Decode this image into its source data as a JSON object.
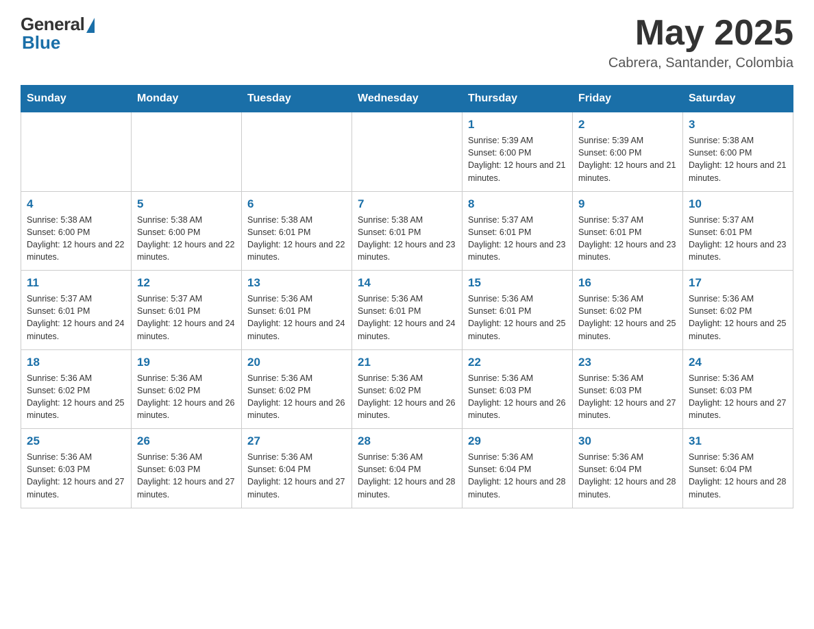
{
  "header": {
    "logo_general": "General",
    "logo_blue": "Blue",
    "month_year": "May 2025",
    "location": "Cabrera, Santander, Colombia"
  },
  "calendar": {
    "days_of_week": [
      "Sunday",
      "Monday",
      "Tuesday",
      "Wednesday",
      "Thursday",
      "Friday",
      "Saturday"
    ],
    "weeks": [
      [
        {
          "day": "",
          "info": ""
        },
        {
          "day": "",
          "info": ""
        },
        {
          "day": "",
          "info": ""
        },
        {
          "day": "",
          "info": ""
        },
        {
          "day": "1",
          "info": "Sunrise: 5:39 AM\nSunset: 6:00 PM\nDaylight: 12 hours and 21 minutes."
        },
        {
          "day": "2",
          "info": "Sunrise: 5:39 AM\nSunset: 6:00 PM\nDaylight: 12 hours and 21 minutes."
        },
        {
          "day": "3",
          "info": "Sunrise: 5:38 AM\nSunset: 6:00 PM\nDaylight: 12 hours and 21 minutes."
        }
      ],
      [
        {
          "day": "4",
          "info": "Sunrise: 5:38 AM\nSunset: 6:00 PM\nDaylight: 12 hours and 22 minutes."
        },
        {
          "day": "5",
          "info": "Sunrise: 5:38 AM\nSunset: 6:00 PM\nDaylight: 12 hours and 22 minutes."
        },
        {
          "day": "6",
          "info": "Sunrise: 5:38 AM\nSunset: 6:01 PM\nDaylight: 12 hours and 22 minutes."
        },
        {
          "day": "7",
          "info": "Sunrise: 5:38 AM\nSunset: 6:01 PM\nDaylight: 12 hours and 23 minutes."
        },
        {
          "day": "8",
          "info": "Sunrise: 5:37 AM\nSunset: 6:01 PM\nDaylight: 12 hours and 23 minutes."
        },
        {
          "day": "9",
          "info": "Sunrise: 5:37 AM\nSunset: 6:01 PM\nDaylight: 12 hours and 23 minutes."
        },
        {
          "day": "10",
          "info": "Sunrise: 5:37 AM\nSunset: 6:01 PM\nDaylight: 12 hours and 23 minutes."
        }
      ],
      [
        {
          "day": "11",
          "info": "Sunrise: 5:37 AM\nSunset: 6:01 PM\nDaylight: 12 hours and 24 minutes."
        },
        {
          "day": "12",
          "info": "Sunrise: 5:37 AM\nSunset: 6:01 PM\nDaylight: 12 hours and 24 minutes."
        },
        {
          "day": "13",
          "info": "Sunrise: 5:36 AM\nSunset: 6:01 PM\nDaylight: 12 hours and 24 minutes."
        },
        {
          "day": "14",
          "info": "Sunrise: 5:36 AM\nSunset: 6:01 PM\nDaylight: 12 hours and 24 minutes."
        },
        {
          "day": "15",
          "info": "Sunrise: 5:36 AM\nSunset: 6:01 PM\nDaylight: 12 hours and 25 minutes."
        },
        {
          "day": "16",
          "info": "Sunrise: 5:36 AM\nSunset: 6:02 PM\nDaylight: 12 hours and 25 minutes."
        },
        {
          "day": "17",
          "info": "Sunrise: 5:36 AM\nSunset: 6:02 PM\nDaylight: 12 hours and 25 minutes."
        }
      ],
      [
        {
          "day": "18",
          "info": "Sunrise: 5:36 AM\nSunset: 6:02 PM\nDaylight: 12 hours and 25 minutes."
        },
        {
          "day": "19",
          "info": "Sunrise: 5:36 AM\nSunset: 6:02 PM\nDaylight: 12 hours and 26 minutes."
        },
        {
          "day": "20",
          "info": "Sunrise: 5:36 AM\nSunset: 6:02 PM\nDaylight: 12 hours and 26 minutes."
        },
        {
          "day": "21",
          "info": "Sunrise: 5:36 AM\nSunset: 6:02 PM\nDaylight: 12 hours and 26 minutes."
        },
        {
          "day": "22",
          "info": "Sunrise: 5:36 AM\nSunset: 6:03 PM\nDaylight: 12 hours and 26 minutes."
        },
        {
          "day": "23",
          "info": "Sunrise: 5:36 AM\nSunset: 6:03 PM\nDaylight: 12 hours and 27 minutes."
        },
        {
          "day": "24",
          "info": "Sunrise: 5:36 AM\nSunset: 6:03 PM\nDaylight: 12 hours and 27 minutes."
        }
      ],
      [
        {
          "day": "25",
          "info": "Sunrise: 5:36 AM\nSunset: 6:03 PM\nDaylight: 12 hours and 27 minutes."
        },
        {
          "day": "26",
          "info": "Sunrise: 5:36 AM\nSunset: 6:03 PM\nDaylight: 12 hours and 27 minutes."
        },
        {
          "day": "27",
          "info": "Sunrise: 5:36 AM\nSunset: 6:04 PM\nDaylight: 12 hours and 27 minutes."
        },
        {
          "day": "28",
          "info": "Sunrise: 5:36 AM\nSunset: 6:04 PM\nDaylight: 12 hours and 28 minutes."
        },
        {
          "day": "29",
          "info": "Sunrise: 5:36 AM\nSunset: 6:04 PM\nDaylight: 12 hours and 28 minutes."
        },
        {
          "day": "30",
          "info": "Sunrise: 5:36 AM\nSunset: 6:04 PM\nDaylight: 12 hours and 28 minutes."
        },
        {
          "day": "31",
          "info": "Sunrise: 5:36 AM\nSunset: 6:04 PM\nDaylight: 12 hours and 28 minutes."
        }
      ]
    ]
  }
}
